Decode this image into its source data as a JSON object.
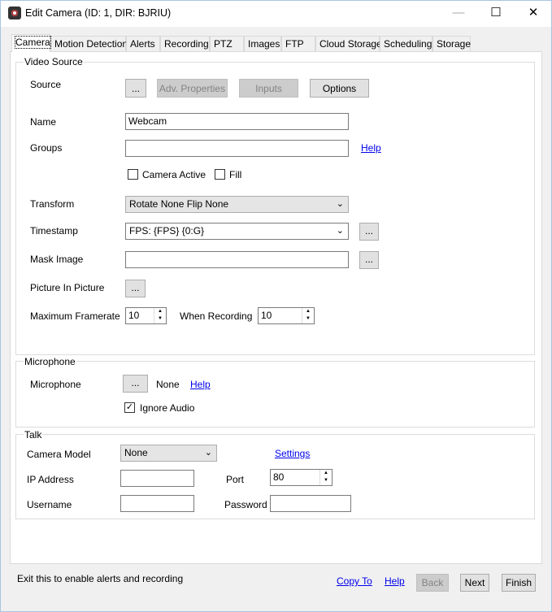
{
  "window": {
    "title": "Edit Camera (ID: 1, DIR: BJRIU)",
    "minimize": "—",
    "maximize": "☐",
    "close": "✕"
  },
  "tabs": [
    "Camera",
    "Motion Detection",
    "Alerts",
    "Recording",
    "PTZ",
    "Images",
    "FTP",
    "Cloud Storage",
    "Scheduling",
    "Storage"
  ],
  "video_source": {
    "group": "Video Source",
    "source_label": "Source",
    "browse": "...",
    "adv_properties": "Adv. Properties",
    "inputs": "Inputs",
    "options": "Options",
    "name_label": "Name",
    "name_value": "Webcam",
    "groups_label": "Groups",
    "groups_value": "",
    "help": "Help",
    "camera_active": "Camera Active",
    "camera_active_checked": false,
    "fill": "Fill",
    "fill_checked": false,
    "transform_label": "Transform",
    "transform_value": "Rotate None Flip None",
    "timestamp_label": "Timestamp",
    "timestamp_value": "FPS: {FPS} {0:G}",
    "mask_label": "Mask Image",
    "mask_value": "",
    "pip_label": "Picture In Picture",
    "max_framerate_label": "Maximum Framerate",
    "max_framerate_value": "10",
    "when_recording_label": "When Recording",
    "when_recording_value": "10"
  },
  "microphone": {
    "group": "Microphone",
    "label": "Microphone",
    "browse": "...",
    "value": "None",
    "help": "Help",
    "ignore_audio": "Ignore Audio",
    "ignore_audio_checked": true
  },
  "talk": {
    "group": "Talk",
    "camera_model_label": "Camera Model",
    "camera_model_value": "None",
    "settings": "Settings",
    "ip_label": "IP Address",
    "ip_value": "",
    "port_label": "Port",
    "port_value": "80",
    "username_label": "Username",
    "username_value": "",
    "password_label": "Password",
    "password_value": ""
  },
  "footer": {
    "status": "Exit this to enable alerts and recording",
    "copy_to": "Copy To",
    "help": "Help",
    "back": "Back",
    "next": "Next",
    "finish": "Finish"
  }
}
